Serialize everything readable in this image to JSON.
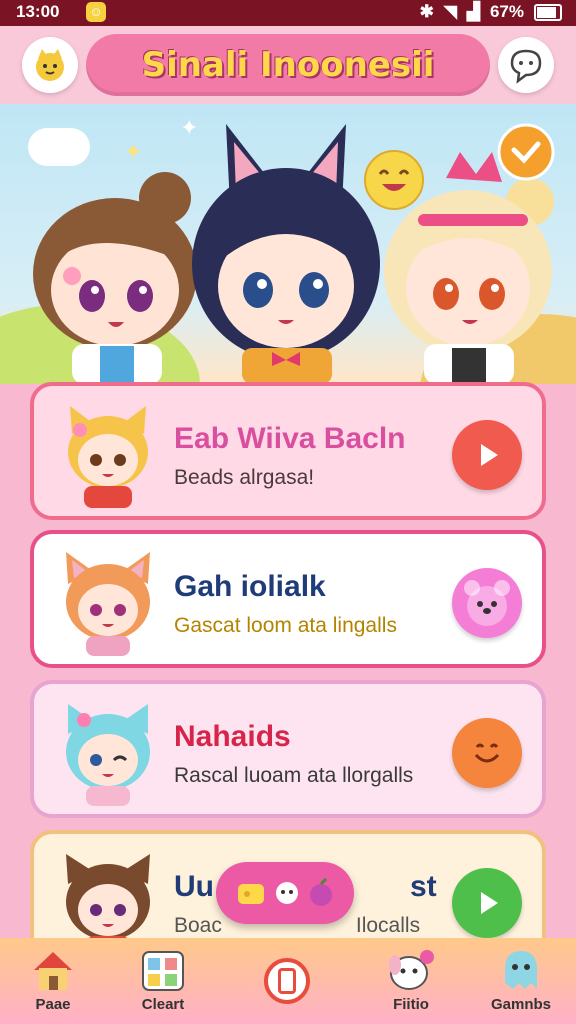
{
  "status_bar": {
    "time": "13:00",
    "battery": "67%"
  },
  "header": {
    "title": "Sinali Inoonesii",
    "left_icon": "chibi-avatar-icon",
    "right_icon": "chat-bubble-icon"
  },
  "cards": [
    {
      "name": "Eab Wiiva Bacln",
      "subtitle": "Beads alrgasa!",
      "action_icon": "play-icon",
      "name_color": "#d94fa0",
      "sub_color": "#4a3a3a",
      "bg": "#ffd9e6",
      "border": "#ef6c8e",
      "action_bg": "#f15a4f"
    },
    {
      "name": "Gah iolialk",
      "subtitle": "Gascat loom ata lingalls",
      "action_icon": "bear-face-icon",
      "name_color": "#1f3b78",
      "sub_color": "#b48400",
      "bg": "#ffffff",
      "border": "#e8508a",
      "action_bg": "#f47ed6"
    },
    {
      "name": "Nahaids",
      "subtitle": "Rascal luoam ata llorgalls",
      "action_icon": "smiley-icon",
      "name_color": "#d6244a",
      "sub_color": "#3a3a3a",
      "bg": "#fde4f0",
      "border": "#e6a4cf",
      "action_bg": "#f5843c"
    },
    {
      "name": "Uu",
      "subtitle": "Boac",
      "subtitle_tail": "Ilocalls",
      "name_tail": "st",
      "action_icon": "play-icon",
      "name_color": "#1f3b78",
      "sub_color": "#555555",
      "bg": "#fff2dc",
      "border": "#f2c07f",
      "action_bg": "#4fbf4b"
    }
  ],
  "nav": [
    {
      "label": "Paae",
      "icon": "house-icon"
    },
    {
      "label": "Cleart",
      "icon": "calendar-grid-icon"
    },
    {
      "label": "",
      "icon": "record-icon"
    },
    {
      "label": "Fiitio",
      "icon": "puppy-icon"
    },
    {
      "label": "Gamnbs",
      "icon": "ghost-icon"
    }
  ],
  "colors": {
    "pink": "#f27aa6",
    "title": "#ffd84a",
    "status": "#7a1424"
  }
}
